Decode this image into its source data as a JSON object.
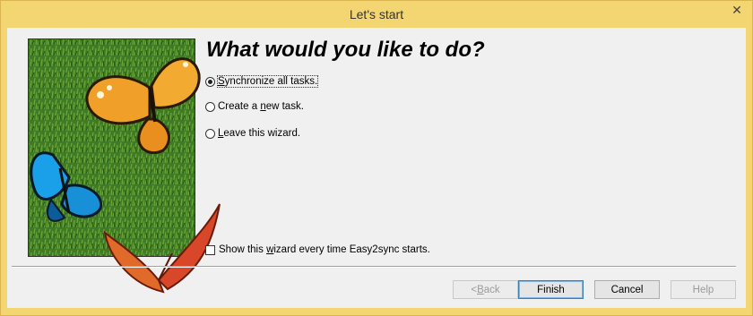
{
  "window": {
    "title": "Let's start",
    "close_symbol": "✕",
    "title_bar_color": "#f3d572"
  },
  "heading": "What would you like to do?",
  "options": [
    {
      "label_pre": "",
      "accel": "S",
      "label_post": "ynchronize all tasks.",
      "checked": true
    },
    {
      "label_pre": "Create a ",
      "accel": "n",
      "label_post": "ew task.",
      "checked": false
    },
    {
      "label_pre": "",
      "accel": "L",
      "label_post": "eave this wizard.",
      "checked": false
    }
  ],
  "show_wizard": {
    "label_pre": "Show this ",
    "accel": "w",
    "label_post": "izard every time Easy2sync starts.",
    "checked": false
  },
  "buttons": {
    "back": {
      "prefix": "< ",
      "accel": "B",
      "rest": "ack"
    },
    "finish": "Finish",
    "cancel": "Cancel",
    "help": "Help"
  },
  "icons": {
    "close": "close-icon",
    "banner": "butterflies-on-grass-image"
  }
}
